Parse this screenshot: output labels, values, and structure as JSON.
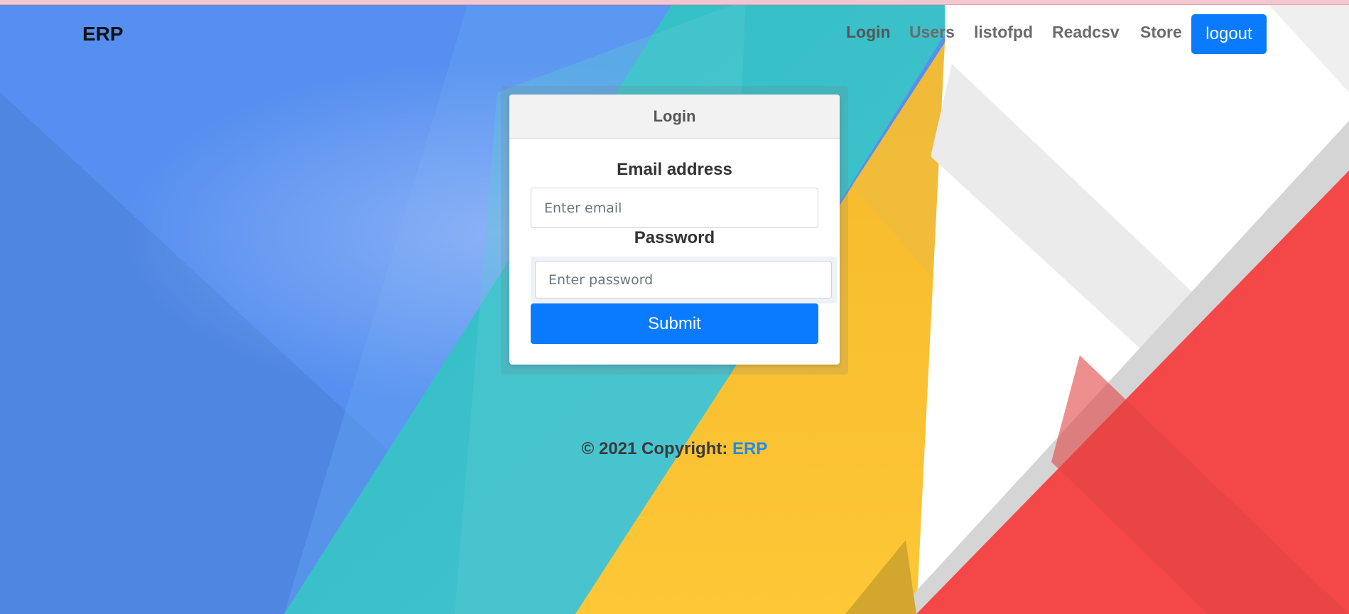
{
  "navbar": {
    "brand": "ERP",
    "links": [
      "Login",
      "Users",
      "listofpd",
      "Readcsv",
      "Store"
    ],
    "logout_label": "logout"
  },
  "login_card": {
    "title": "Login",
    "email_label": "Email address",
    "email_placeholder": "Enter email",
    "email_value": "",
    "password_label": "Password",
    "password_placeholder": "Enter password",
    "password_value": "",
    "submit_label": "Submit"
  },
  "footer": {
    "text": "© 2021 Copyright: ",
    "link_label": "ERP"
  },
  "colors": {
    "primary_button": "#0a7bff",
    "footer_link": "#1f8cf0"
  }
}
